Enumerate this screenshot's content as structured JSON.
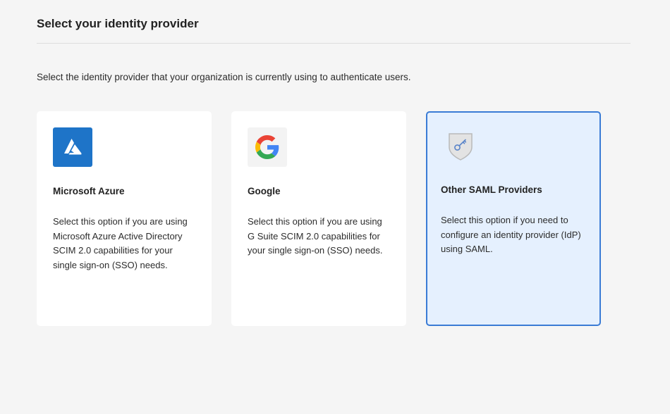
{
  "header": {
    "title": "Select your identity provider"
  },
  "description": "Select the identity provider that your organization is currently using to authenticate users.",
  "cards": [
    {
      "icon": "azure-logo-icon",
      "name": "Microsoft Azure",
      "description": "Select this option if you are using Microsoft Azure Active Directory SCIM 2.0 capabilities for your single sign-on (SSO) needs.",
      "selected": false
    },
    {
      "icon": "google-logo-icon",
      "name": "Google",
      "description": "Select this option if you are using G Suite SCIM 2.0 capabilities for your single sign-on (SSO) needs.",
      "selected": false
    },
    {
      "icon": "shield-key-icon",
      "name": "Other SAML Providers",
      "description": "Select this option if you need to configure an identity provider (IdP) using SAML.",
      "selected": true
    }
  ],
  "colors": {
    "selected_border": "#3a7bd5",
    "selected_background": "#e5f0fe",
    "azure_blue": "#1e74c8"
  }
}
